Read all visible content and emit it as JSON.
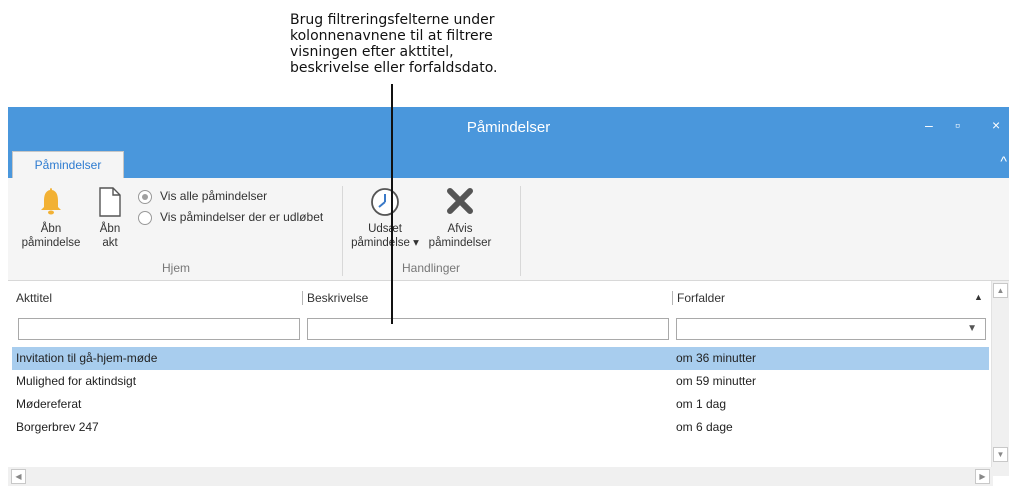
{
  "callout": {
    "text_lines": [
      "Brug filtreringsfelterne under",
      "kolonnenavnene til at filtrere",
      "visningen efter akttitel,",
      "beskrivelse eller forfaldsdato."
    ]
  },
  "window": {
    "title": "Påmindelser",
    "minimize": "–",
    "maximize": "▫",
    "close": "×"
  },
  "ribbon_tab": {
    "label": "Påmindelser",
    "collapse": "^"
  },
  "ribbon": {
    "hjem": {
      "label": "Hjem",
      "open_reminder": [
        "Åbn",
        "påmindelse"
      ],
      "open_case": [
        "Åbn",
        "akt"
      ],
      "radio_all": "Vis alle påmindelser",
      "radio_expired": "Vis påmindelser der er udløbet"
    },
    "handlinger": {
      "label": "Handlinger",
      "postpone": [
        "Udsæt",
        "påmindelse ▾"
      ],
      "dismiss": [
        "Afvis",
        "påmindelser"
      ]
    }
  },
  "grid": {
    "columns": [
      "Akttitel",
      "Beskrivelse",
      "Forfalder"
    ],
    "rows": [
      {
        "title": "Invitation til gå-hjem-møde",
        "description": "",
        "due": "om 36 minutter"
      },
      {
        "title": "Mulighed for aktindsigt",
        "description": "",
        "due": "om 59 minutter"
      },
      {
        "title": "Mødereferat",
        "description": "",
        "due": "om 1 dag"
      },
      {
        "title": "Borgerbrev 247",
        "description": "",
        "due": "om 6 dage"
      }
    ]
  },
  "colors": {
    "accent": "#4a97dc",
    "selection": "#a8cdee",
    "bell": "#f2b134"
  },
  "icons": [
    "bell-icon",
    "document-icon",
    "clock-icon",
    "dismiss-x-icon"
  ]
}
